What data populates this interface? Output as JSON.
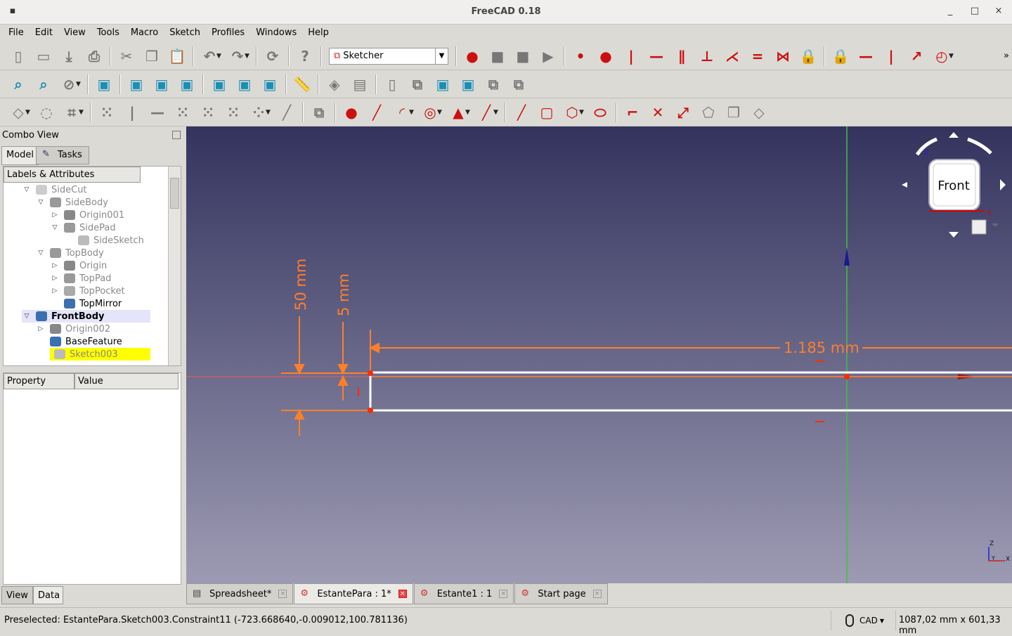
{
  "window": {
    "title": "FreeCAD 0.18",
    "minimize": "_",
    "maximize": "□",
    "close": "×"
  },
  "menu": [
    "File",
    "Edit",
    "View",
    "Tools",
    "Macro",
    "Sketch",
    "Profiles",
    "Windows",
    "Help"
  ],
  "toolbars": {
    "row1a": [
      "new-file-icon",
      "open-file-icon",
      "save-icon",
      "print-icon",
      "|",
      "cut-icon",
      "copy-icon",
      "paste-icon",
      "|",
      "undo-icon",
      "undo-dropdown",
      "redo-icon",
      "redo-dropdown",
      "|",
      "refresh-icon",
      "|",
      "whats-this-icon"
    ],
    "workbench": "Sketcher",
    "row1b": [
      "macro-record-icon",
      "macro-stop-icon",
      "macro-edit-icon",
      "macro-run-icon",
      "|",
      "constrain-coincident-icon",
      "constrain-point-on-object-icon",
      "constrain-vertical-icon",
      "constrain-horizontal-icon",
      "constrain-parallel-icon",
      "constrain-perpendicular-icon",
      "constrain-tangent-icon",
      "constrain-equal-icon",
      "constrain-symmetric-icon",
      "constrain-block-icon",
      "|",
      "constrain-lock-icon",
      "constrain-horizontal-distance-icon",
      "constrain-vertical-distance-icon",
      "constrain-distance-icon",
      "constrain-radius-icon",
      "constrain-dropdown"
    ],
    "row2": [
      "fit-all-icon",
      "fit-selection-icon",
      "draw-style-icon",
      "draw-style-dropdown",
      "|",
      "isometric-view-icon",
      "|",
      "front-view-icon",
      "top-view-icon",
      "right-view-icon",
      "|",
      "rear-view-icon",
      "bottom-view-icon",
      "left-view-icon",
      "|",
      "measure-icon",
      "|",
      "part-icon",
      "group-icon",
      "|",
      "new-sketch-icon",
      "leave-sketch-icon",
      "view-sketch-icon",
      "view-section-icon",
      "map-sketch-icon",
      "reorient-sketch-icon"
    ],
    "row3": [
      "geometry-mode-icon",
      "geometry-mode-dropdown",
      "close-shape-icon",
      "connect-edges-icon",
      "select-constraints-dropdown",
      "|",
      "select-origin-icon",
      "select-vertical-axis-icon",
      "select-horizontal-axis-icon",
      "select-redundant-icon",
      "select-conflicting-icon",
      "select-elements-icon",
      "show-hide-icon",
      "show-hide-dropdown",
      "bspline-icon",
      "|",
      "validate-sketch-icon",
      "|",
      "create-point-icon",
      "create-line-icon",
      "create-arc-icon",
      "arc-dropdown",
      "create-circle-icon",
      "circle-dropdown",
      "create-conic-icon",
      "conic-dropdown",
      "create-bspline-icon",
      "bspline-dropdown",
      "|",
      "create-polyline-icon",
      "create-rectangle-icon",
      "create-polygon-icon",
      "polygon-dropdown",
      "create-slot-icon",
      "|",
      "fillet-icon",
      "trim-icon",
      "extend-icon",
      "external-geometry-icon",
      "carbon-copy-icon",
      "construction-mode-icon"
    ]
  },
  "combo": {
    "title": "Combo View",
    "tabs": [
      "Model",
      "Tasks"
    ],
    "tree_header": "Labels & Attributes",
    "tree": [
      {
        "label": "SideCut",
        "level": 0,
        "twisty": "open",
        "style": "gray",
        "icon": "cut-icon"
      },
      {
        "label": "SideBody",
        "level": 1,
        "twisty": "open",
        "style": "gray",
        "icon": "body-icon"
      },
      {
        "label": "Origin001",
        "level": 2,
        "twisty": "closed",
        "style": "gray",
        "icon": "origin-icon"
      },
      {
        "label": "SidePad",
        "level": 2,
        "twisty": "open",
        "style": "gray",
        "icon": "pad-icon"
      },
      {
        "label": "SideSketch",
        "level": 3,
        "twisty": "",
        "style": "gray",
        "icon": "sketch-icon"
      },
      {
        "label": "TopBody",
        "level": 1,
        "twisty": "open",
        "style": "gray",
        "icon": "body-icon"
      },
      {
        "label": "Origin",
        "level": 2,
        "twisty": "closed",
        "style": "gray",
        "icon": "origin-icon"
      },
      {
        "label": "TopPad",
        "level": 2,
        "twisty": "closed",
        "style": "gray",
        "icon": "pad-icon"
      },
      {
        "label": "TopPocket",
        "level": 2,
        "twisty": "closed",
        "style": "gray",
        "icon": "pocket-icon"
      },
      {
        "label": "TopMirror",
        "level": 2,
        "twisty": "",
        "style": "normal",
        "icon": "mirror-icon"
      },
      {
        "label": "FrontBody",
        "level": 0,
        "twisty": "open",
        "style": "active",
        "icon": "body-icon"
      },
      {
        "label": "Origin002",
        "level": 1,
        "twisty": "closed",
        "style": "gray",
        "icon": "origin-icon"
      },
      {
        "label": "BaseFeature",
        "level": 1,
        "twisty": "",
        "style": "normal",
        "icon": "base-feature-icon"
      },
      {
        "label": "Sketch003",
        "level": 1,
        "twisty": "",
        "style": "selected",
        "icon": "sketch-icon"
      }
    ],
    "prop_headers": [
      "Property",
      "Value"
    ],
    "bottom_tabs": [
      "View",
      "Data"
    ]
  },
  "viewport": {
    "dimensions": [
      "50 mm",
      "5 mm",
      "1.185 mm"
    ],
    "navcube_face": "Front",
    "axes": {
      "z": "Z",
      "x": "X",
      "y": "Y"
    }
  },
  "doc_tabs": [
    {
      "label": "Spreadsheet*",
      "active": false
    },
    {
      "label": "EstantePara : 1*",
      "active": true
    },
    {
      "label": "Estante1 : 1",
      "active": false
    },
    {
      "label": "Start page",
      "active": false
    }
  ],
  "status": {
    "message": "Preselected: EstantePara.Sketch003.Constraint11 (-723.668640,-0.009012,100.781136)",
    "nav_style": "CAD",
    "dimensions": "1087,02 mm x 601,33 mm"
  },
  "colors": {
    "dimension": "#ff7f2a",
    "geometry": "#ffffff",
    "x_axis": "#d05050",
    "y_axis": "#40c040",
    "selected": "#ffff00",
    "vertex": "#ff2a00"
  }
}
